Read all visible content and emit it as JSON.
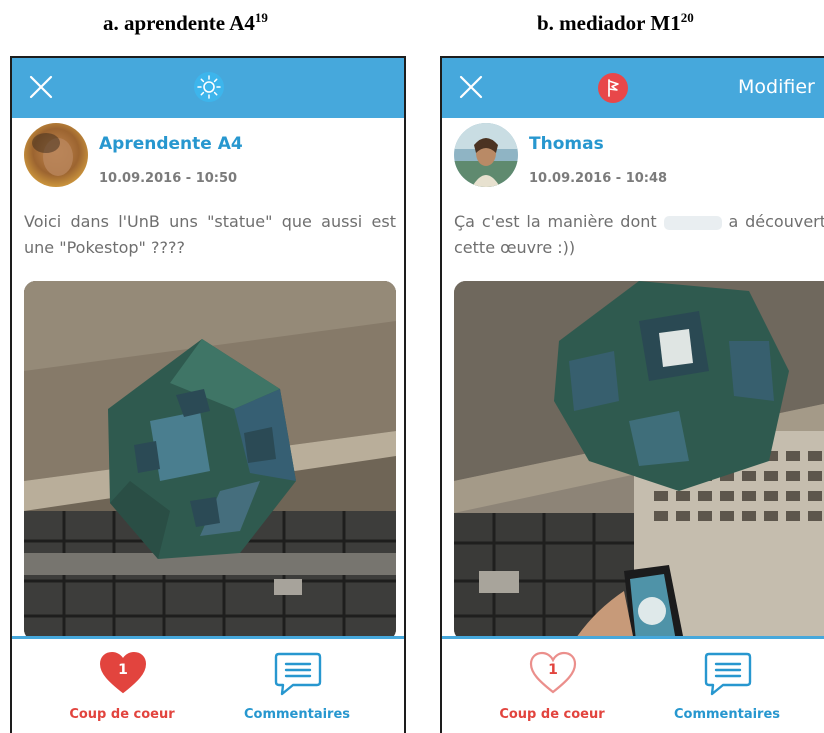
{
  "captions": {
    "a_text": "a. aprendente A4",
    "a_sup": "19",
    "b_text": "b. mediador M1",
    "b_sup": "20"
  },
  "panel_a": {
    "topbar": {
      "close_icon": "close-icon",
      "mode_icon": "sun-icon"
    },
    "author": "Aprendente A4",
    "date": "10.09.2016 - 10:50",
    "text": "Voici dans l'UnB uns \"statue\" que aussi est une \"Pokestop\" ????",
    "actions": {
      "like_count": "1",
      "like_label": "Coup de coeur",
      "comments_label": "Commentaires"
    }
  },
  "panel_b": {
    "topbar": {
      "close_icon": "close-icon",
      "flag_icon": "flag-icon",
      "modifier_label": "Modifier"
    },
    "author": "Thomas",
    "date": "10.09.2016 - 10:48",
    "text_before": "Ça c'est la manière dont",
    "text_after": "a découvert cette œuvre :))",
    "actions": {
      "like_count": "1",
      "like_label": "Coup de coeur",
      "comments_label": "Commentaires"
    }
  },
  "colors": {
    "topbar": "#46a8dc",
    "name_blue": "#2797cf",
    "like_red": "#e2443e",
    "flag_red": "#e8474a"
  }
}
